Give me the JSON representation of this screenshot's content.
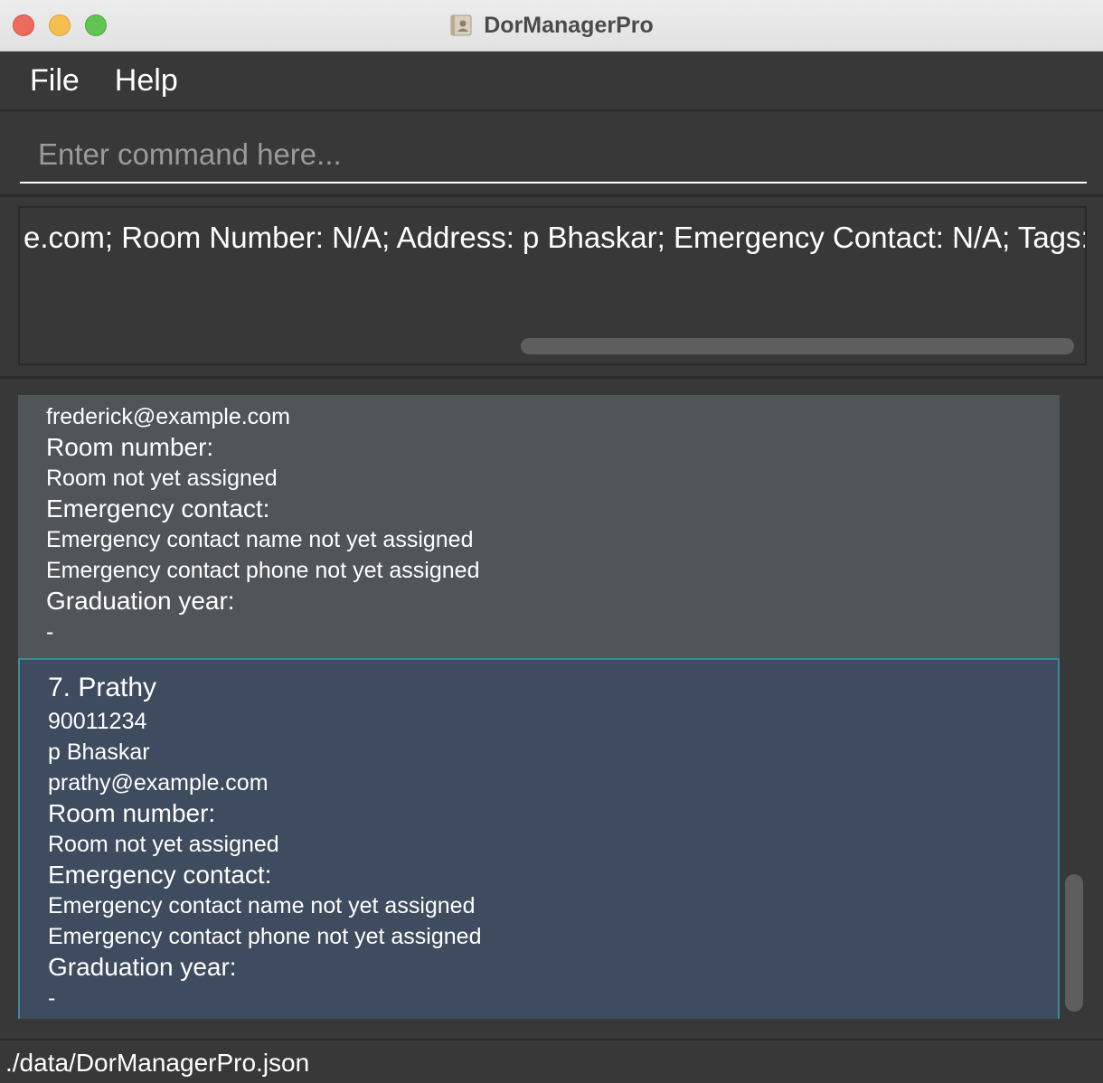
{
  "window": {
    "title": "DorManagerPro"
  },
  "menu": {
    "items": [
      {
        "label": "File"
      },
      {
        "label": "Help"
      }
    ]
  },
  "command": {
    "value": "",
    "placeholder": "Enter command here..."
  },
  "result": {
    "text": "e.com; Room Number: N/A; Address: p Bhaskar; Emergency Contact: N/A; Tags:"
  },
  "persons": [
    {
      "name": "",
      "email": "frederick@example.com",
      "room_label": "Room number:",
      "room_value": "Room not yet assigned",
      "emergency_label": "Emergency contact:",
      "emergency_name": "Emergency contact name not yet assigned",
      "emergency_phone": "Emergency contact phone not yet assigned",
      "grad_label": "Graduation year:",
      "grad_value": "-"
    },
    {
      "name": "7. Prathy",
      "phone": "90011234",
      "address": "p Bhaskar",
      "email": "prathy@example.com",
      "room_label": "Room number:",
      "room_value": "Room not yet assigned",
      "emergency_label": "Emergency contact:",
      "emergency_name": "Emergency contact name not yet assigned",
      "emergency_phone": "Emergency contact phone not yet assigned",
      "grad_label": "Graduation year:",
      "grad_value": "-",
      "selected": true
    }
  ],
  "status": {
    "file_path": "./data/DorManagerPro.json"
  },
  "colors": {
    "background": "#383838",
    "card_default": "#505658",
    "card_selected": "#3f4b5e",
    "selected_border": "#3a8a9a",
    "text": "#ffffff",
    "placeholder": "#9a9a9a"
  },
  "icons": {
    "app": "address-book-icon"
  }
}
